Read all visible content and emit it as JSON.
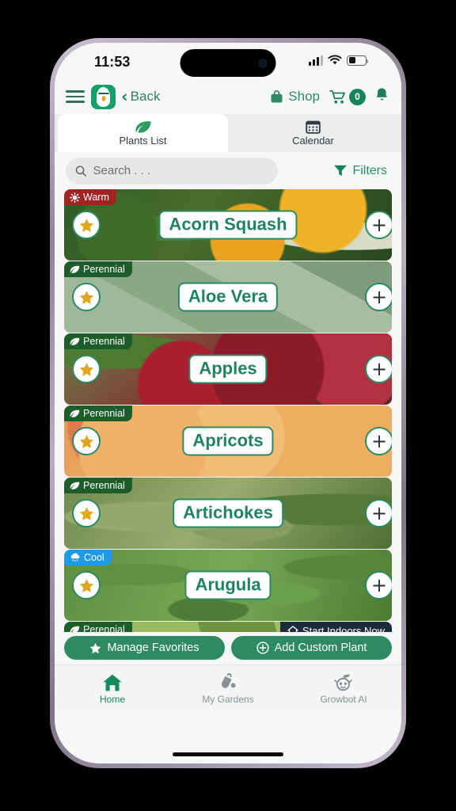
{
  "status_bar": {
    "time": "11:53",
    "signal_icon": "cellular-signal-icon",
    "wifi_icon": "wifi-icon",
    "battery_icon": "battery-icon"
  },
  "header": {
    "menu_icon": "hamburger-menu-icon",
    "logo_icon": "app-logo-icon",
    "back_chevron": "‹",
    "back_label": "Back",
    "shop_icon": "shop-basket-icon",
    "shop_label": "Shop",
    "cart_icon": "shopping-cart-icon",
    "cart_count": "0",
    "bell_icon": "notification-bell-icon"
  },
  "tabs": [
    {
      "label": "Plants List",
      "icon": "leaf-icon",
      "active": true
    },
    {
      "label": "Calendar",
      "icon": "calendar-icon",
      "active": false
    }
  ],
  "search": {
    "placeholder": "Search . . .",
    "value": "",
    "search_icon": "search-icon",
    "filters_label": "Filters",
    "filters_icon": "funnel-filter-icon"
  },
  "plants": [
    {
      "name": "Acorn Squash",
      "badge_label": "Warm",
      "badge_type": "warm",
      "badge_icon": "sun-icon",
      "favorite_icon": "star-icon",
      "add_icon": "plus-icon",
      "bg_class": "bg-squash"
    },
    {
      "name": "Aloe Vera",
      "badge_label": "Perennial",
      "badge_type": "perennial",
      "badge_icon": "leaf-icon",
      "favorite_icon": "star-icon",
      "add_icon": "plus-icon",
      "bg_class": "bg-aloe"
    },
    {
      "name": "Apples",
      "badge_label": "Perennial",
      "badge_type": "perennial",
      "badge_icon": "leaf-icon",
      "favorite_icon": "star-icon",
      "add_icon": "plus-icon",
      "bg_class": "bg-apple"
    },
    {
      "name": "Apricots",
      "badge_label": "Perennial",
      "badge_type": "perennial",
      "badge_icon": "leaf-icon",
      "favorite_icon": "star-icon",
      "add_icon": "plus-icon",
      "bg_class": "bg-apricot"
    },
    {
      "name": "Artichokes",
      "badge_label": "Perennial",
      "badge_type": "perennial",
      "badge_icon": "leaf-icon",
      "favorite_icon": "star-icon",
      "add_icon": "plus-icon",
      "bg_class": "bg-artichoke"
    },
    {
      "name": "Arugula",
      "badge_label": "Cool",
      "badge_type": "cool",
      "badge_icon": "snow-cloud-icon",
      "favorite_icon": "star-icon",
      "add_icon": "plus-icon",
      "bg_class": "bg-arugula"
    },
    {
      "name": "",
      "badge_label": "Perennial",
      "badge_type": "perennial",
      "badge_icon": "leaf-icon",
      "favorite_icon": "star-icon",
      "add_icon": "plus-icon",
      "bg_class": "bg-asparagus",
      "indoor_label": "Start Indoors Now",
      "indoor_icon": "home-indoors-icon"
    }
  ],
  "actions": [
    {
      "label": "Manage Favorites",
      "icon": "star-icon"
    },
    {
      "label": "Add Custom Plant",
      "icon": "plus-circle-icon"
    }
  ],
  "bottom_nav": [
    {
      "label": "Home",
      "icon": "house-icon",
      "active": true
    },
    {
      "label": "My Gardens",
      "icon": "watering-can-icon",
      "active": false
    },
    {
      "label": "Growbot AI",
      "icon": "growbot-mascot-icon",
      "active": false
    }
  ],
  "colors": {
    "brand_green": "#2d8a62",
    "perennial_badge": "#1d5d2a",
    "warm_badge": "#a32222",
    "cool_badge": "#1e9ae8",
    "indoor_badge": "#1d2b3a",
    "favorite_star": "#e0a61c"
  }
}
